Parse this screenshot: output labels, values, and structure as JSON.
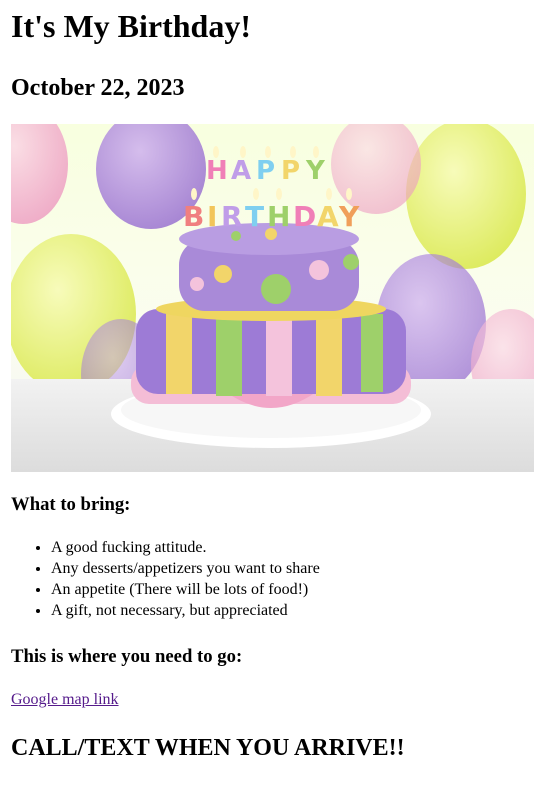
{
  "header": {
    "title": "It's My Birthday!",
    "date": "October 22, 2023"
  },
  "image": {
    "subject": "cake-image",
    "colors": {
      "background_top": "#f3ffd2",
      "balloon_purple": "#a77bd9",
      "balloon_yellow": "#e8f26b",
      "balloon_pink": "#f2a8c9",
      "cake_purple": "#9d7bd6",
      "cake_pink": "#f4c3dc",
      "stripe_yellow": "#f2d56a",
      "stripe_green": "#9ed06a",
      "table": "#e9e9e9"
    }
  },
  "bring": {
    "heading": "What to bring:",
    "items": [
      "A good fucking attitude.",
      "Any desserts/appetizers you want to share",
      "An appetite (There will be lots of food!)",
      "A gift, not necessary, but appreciated"
    ]
  },
  "location": {
    "heading": "This is where you need to go:",
    "link_label": "Google map link"
  },
  "callout": "CALL/TEXT WHEN YOU ARRIVE!!"
}
